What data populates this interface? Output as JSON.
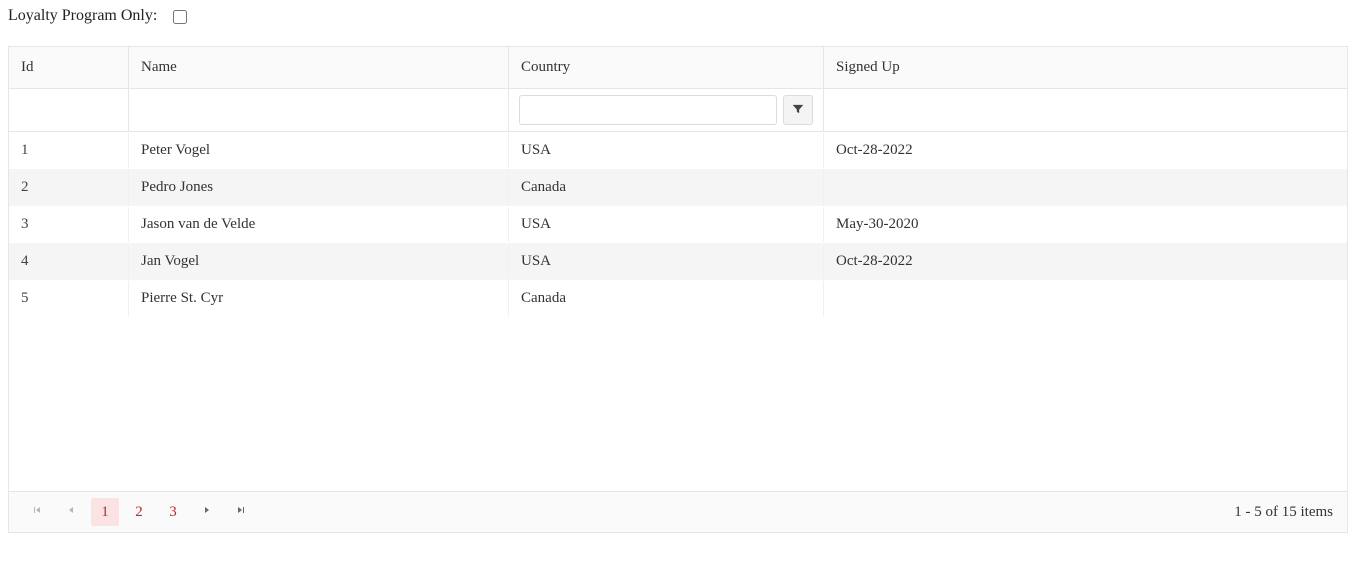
{
  "filter": {
    "loyalty_label": "Loyalty Program Only:"
  },
  "columns": {
    "id": "Id",
    "name": "Name",
    "country": "Country",
    "signed_up": "Signed Up"
  },
  "country_filter_value": "",
  "rows": [
    {
      "id": "1",
      "name": "Peter Vogel",
      "country": "USA",
      "signed_up": "Oct-28-2022"
    },
    {
      "id": "2",
      "name": "Pedro Jones",
      "country": "Canada",
      "signed_up": ""
    },
    {
      "id": "3",
      "name": "Jason van de Velde",
      "country": "USA",
      "signed_up": "May-30-2020"
    },
    {
      "id": "4",
      "name": "Jan Vogel",
      "country": "USA",
      "signed_up": "Oct-28-2022"
    },
    {
      "id": "5",
      "name": "Pierre St. Cyr",
      "country": "Canada",
      "signed_up": ""
    }
  ],
  "pagination": {
    "pages": [
      "1",
      "2",
      "3"
    ],
    "active_page": "1",
    "summary": "1 - 5 of 15 items"
  }
}
